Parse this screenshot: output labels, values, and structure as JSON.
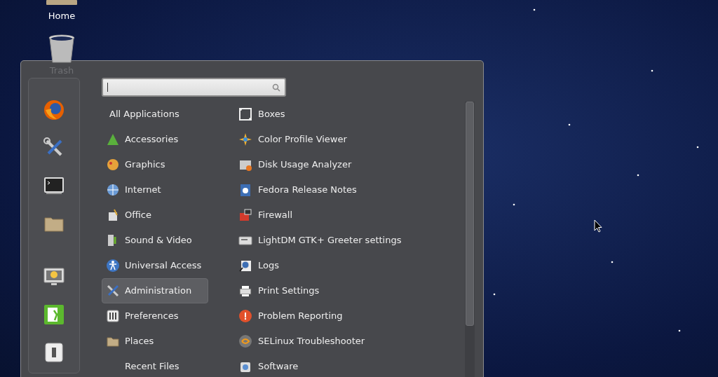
{
  "desktop_icons": [
    {
      "label": "Home"
    },
    {
      "label": "Trash"
    }
  ],
  "menu": {
    "categories": [
      {
        "kind": "plain",
        "label": "All Applications",
        "selected": false
      },
      {
        "kind": "icon",
        "label": "Accessories",
        "selected": false
      },
      {
        "kind": "icon",
        "label": "Graphics",
        "selected": false
      },
      {
        "kind": "icon",
        "label": "Internet",
        "selected": false
      },
      {
        "kind": "icon",
        "label": "Office",
        "selected": false
      },
      {
        "kind": "icon",
        "label": "Sound & Video",
        "selected": false
      },
      {
        "kind": "icon",
        "label": "Universal Access",
        "selected": false
      },
      {
        "kind": "icon",
        "label": "Administration",
        "selected": true
      },
      {
        "kind": "icon",
        "label": "Preferences",
        "selected": false
      },
      {
        "kind": "icon",
        "label": "Places",
        "selected": false
      },
      {
        "kind": "plain",
        "label": "Recent Files",
        "selected": false
      }
    ],
    "applications": [
      "Boxes",
      "Color Profile Viewer",
      "Disk Usage Analyzer",
      "Fedora Release Notes",
      "Firewall",
      "LightDM GTK+ Greeter settings",
      "Logs",
      "Print Settings",
      "Problem Reporting",
      "SELinux Troubleshooter",
      "Software"
    ]
  }
}
